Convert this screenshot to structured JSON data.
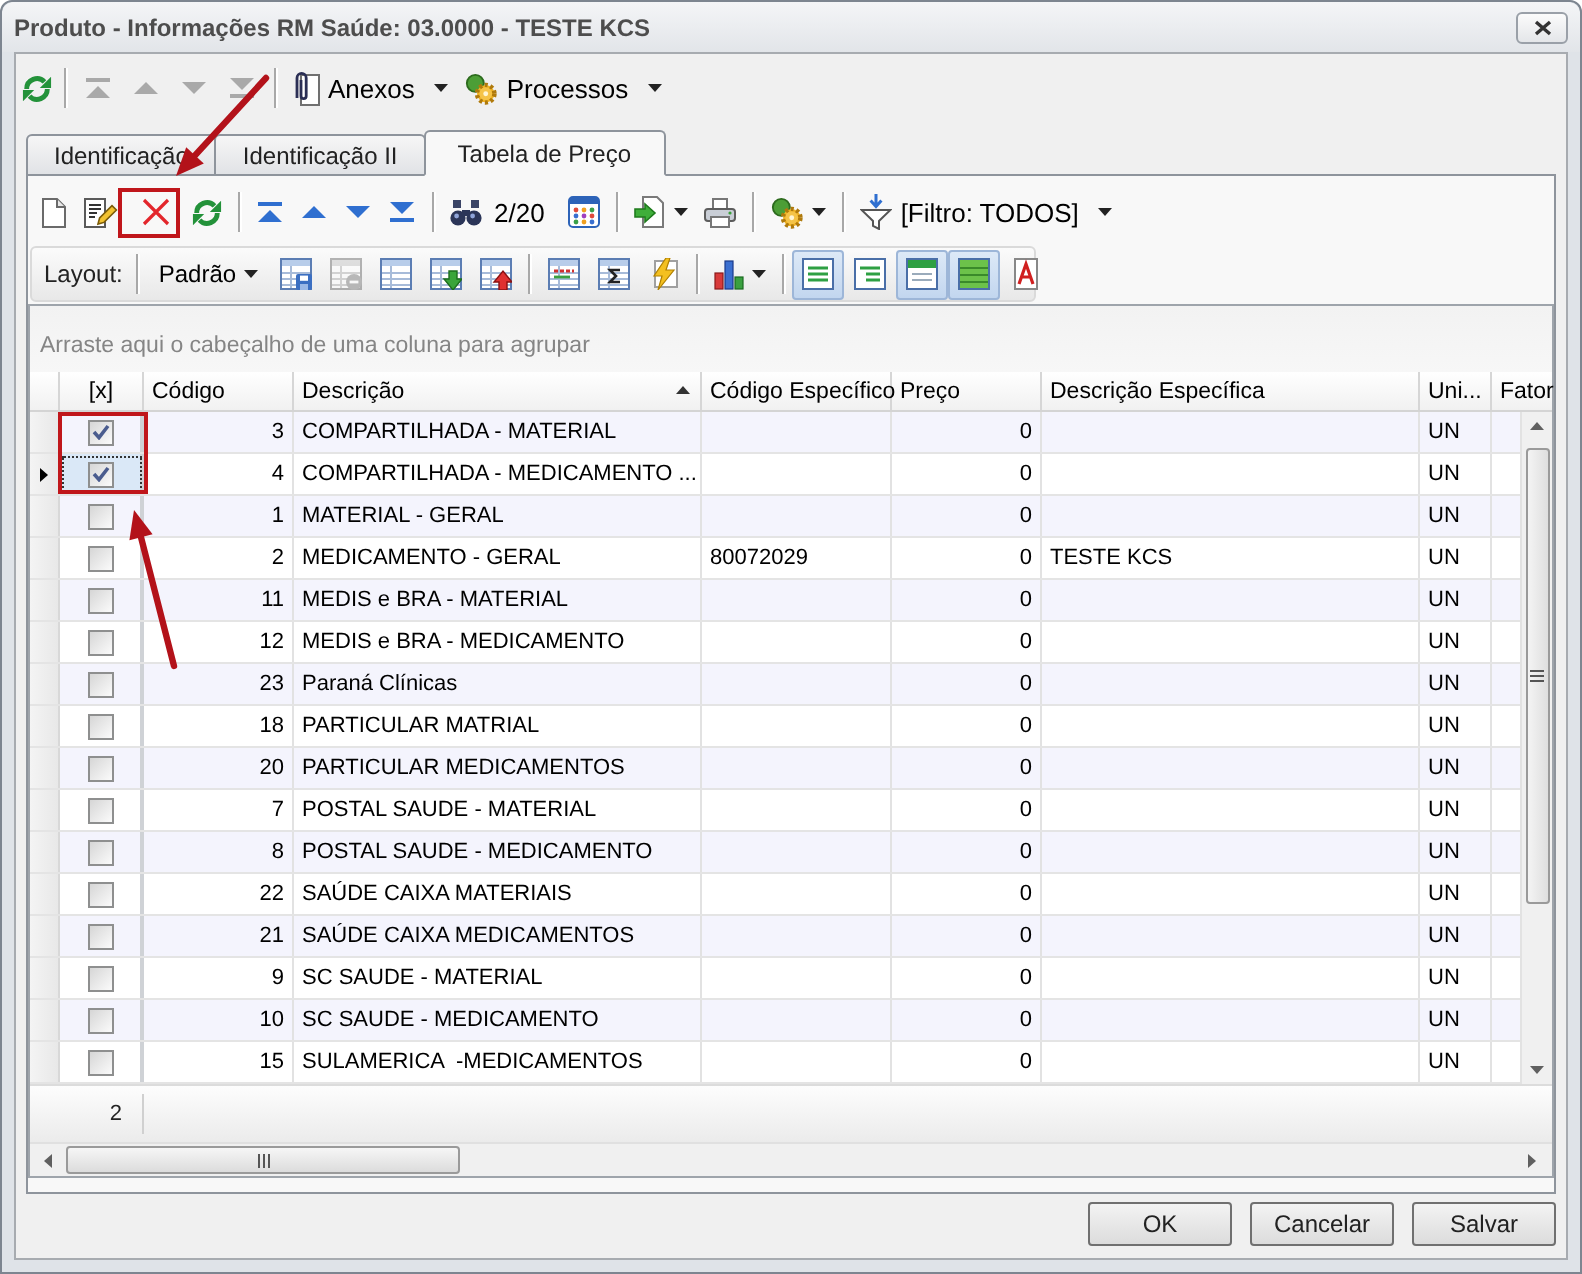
{
  "window": {
    "title": "Produto - Informações RM Saúde: 03.0000 - TESTE KCS"
  },
  "toolbar": {
    "nav_buttons": [
      {
        "kind": "first",
        "disabled": true
      },
      {
        "kind": "previous",
        "disabled": true
      },
      {
        "kind": "next",
        "disabled": true
      },
      {
        "kind": "last",
        "disabled": true
      }
    ],
    "menus": [
      {
        "kind": "attachments",
        "label": "Anexos"
      },
      {
        "kind": "processes",
        "label": "Processos"
      }
    ]
  },
  "tabs": [
    {
      "label": "Identificação",
      "selected": false
    },
    {
      "label": "Identificação II",
      "selected": false
    },
    {
      "label": "Tabela de Preço",
      "selected": true
    }
  ],
  "grid_toolbar": {
    "nav_buttons": [
      {
        "kind": "first",
        "disabled": false
      },
      {
        "kind": "previous",
        "disabled": false
      },
      {
        "kind": "next",
        "disabled": false
      },
      {
        "kind": "last",
        "disabled": false
      }
    ],
    "record_counter": "2/20",
    "filter": "[Filtro: TODOS]"
  },
  "layout_toolbar": {
    "label": "Layout:",
    "layout": "Padrão",
    "layout_buttons": [
      {
        "kind": "save",
        "disabled": false
      },
      {
        "kind": "remove",
        "disabled": true
      },
      {
        "kind": "grid",
        "disabled": false
      },
      {
        "kind": "import",
        "disabled": false
      },
      {
        "kind": "export",
        "disabled": false
      }
    ],
    "view_buttons": [
      {
        "kind": "lines",
        "pressed": true
      },
      {
        "kind": "indented",
        "pressed": false
      },
      {
        "kind": "header",
        "pressed": true
      },
      {
        "kind": "filled",
        "pressed": true
      },
      {
        "kind": "font",
        "pressed": false
      }
    ]
  },
  "grid": {
    "group_hint": "Arraste aqui o cabeçalho de uma coluna para agrupar",
    "columns": [
      {
        "label": "[x]",
        "sorted": false
      },
      {
        "label": "Código",
        "sorted": false
      },
      {
        "label": "Descrição",
        "sorted": true
      },
      {
        "label": "Código Específico",
        "sorted": false
      },
      {
        "label": "Preço",
        "sorted": false
      },
      {
        "label": "Descrição Específica",
        "sorted": false
      },
      {
        "label": "Uni...",
        "sorted": false
      },
      {
        "label": "Fator",
        "sorted": false
      }
    ],
    "rows": [
      {
        "checked": true,
        "selected": false,
        "code": "3",
        "description": "COMPARTILHADA - MATERIAL",
        "price": "0",
        "column_7": "UN"
      },
      {
        "checked": true,
        "selected": true,
        "code": "4",
        "description": "COMPARTILHADA - MEDICAMENTO",
        "description_more": "...",
        "price": "0",
        "column_7": "UN"
      },
      {
        "checked": false,
        "selected": false,
        "code": "1",
        "description": "MATERIAL - GERAL",
        "price": "0",
        "column_7": "UN"
      },
      {
        "checked": false,
        "selected": false,
        "code": "2",
        "description": "MEDICAMENTO - GERAL",
        "specific_code": "80072029",
        "price": "0",
        "specific_description": "TESTE KCS",
        "column_7": "UN"
      },
      {
        "checked": false,
        "selected": false,
        "code": "11",
        "description": "MEDIS e BRA - MATERIAL",
        "price": "0",
        "column_7": "UN"
      },
      {
        "checked": false,
        "selected": false,
        "code": "12",
        "description": "MEDIS e BRA - MEDICAMENTO",
        "price": "0",
        "column_7": "UN"
      },
      {
        "checked": false,
        "selected": false,
        "code": "23",
        "description": "Paraná Clínicas",
        "price": "0",
        "column_7": "UN"
      },
      {
        "checked": false,
        "selected": false,
        "code": "18",
        "description": "PARTICULAR MATRIAL",
        "price": "0",
        "column_7": "UN"
      },
      {
        "checked": false,
        "selected": false,
        "code": "20",
        "description": "PARTICULAR MEDICAMENTOS",
        "price": "0",
        "column_7": "UN"
      },
      {
        "checked": false,
        "selected": false,
        "code": "7",
        "description": "POSTAL SAUDE - MATERIAL",
        "price": "0",
        "column_7": "UN"
      },
      {
        "checked": false,
        "selected": false,
        "code": "8",
        "description": "POSTAL SAUDE - MEDICAMENTO",
        "price": "0",
        "column_7": "UN"
      },
      {
        "checked": false,
        "selected": false,
        "code": "22",
        "description": "SAÚDE CAIXA MATERIAIS",
        "price": "0",
        "column_7": "UN"
      },
      {
        "checked": false,
        "selected": false,
        "code": "21",
        "description": "SAÚDE CAIXA MEDICAMENTOS",
        "price": "0",
        "column_7": "UN"
      },
      {
        "checked": false,
        "selected": false,
        "code": "9",
        "description": "SC SAUDE - MATERIAL",
        "price": "0",
        "column_7": "UN"
      },
      {
        "checked": false,
        "selected": false,
        "code": "10",
        "description": "SC SAUDE - MEDICAMENTO",
        "price": "0",
        "column_7": "UN"
      },
      {
        "checked": false,
        "selected": false,
        "code": "15",
        "description": "SULAMERICA  -MEDICAMENTOS",
        "price": "0",
        "column_7": "UN"
      }
    ],
    "footer": {
      "checked_count": "2"
    }
  },
  "buttons": [
    {
      "label": "OK"
    },
    {
      "label": "Cancelar"
    },
    {
      "label": "Salvar"
    }
  ]
}
